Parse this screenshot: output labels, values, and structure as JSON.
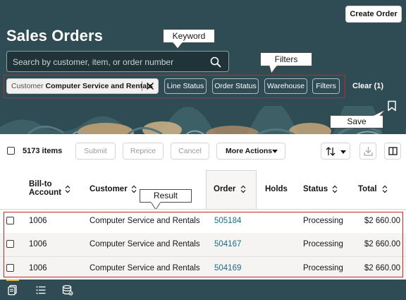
{
  "header": {
    "create_button_label": "Create Order",
    "title": "Sales Orders",
    "search_placeholder": "Search by customer, item, or order number",
    "filter_chips": {
      "customer_key": "Customer",
      "customer_value": "Computer Service and Rentals",
      "line_status": "Line Status",
      "order_status": "Order Status",
      "warehouse": "Warehouse",
      "filters": "Filters"
    },
    "clear_label": "Clear (1)"
  },
  "callouts": {
    "keyword": "Keyword",
    "filters": "Filters",
    "save": "Save",
    "result": "Result"
  },
  "toolbar": {
    "items_count": "5173 items",
    "submit": "Submit",
    "reprice": "Reprice",
    "cancel": "Cancel",
    "more_actions": "More Actions"
  },
  "table": {
    "columns": {
      "bill_to_line1": "Bill-to",
      "bill_to_line2": "Account",
      "customer": "Customer",
      "order": "Order",
      "holds": "Holds",
      "status": "Status",
      "total": "Total"
    },
    "rows": [
      {
        "account": "1006",
        "customer": "Computer Service and Rentals",
        "order": "505184",
        "holds": "",
        "status": "Processing",
        "total": "$2 660.00"
      },
      {
        "account": "1006",
        "customer": "Computer Service and Rentals",
        "order": "504167",
        "holds": "",
        "status": "Processing",
        "total": "$2 660.00"
      },
      {
        "account": "1006",
        "customer": "Computer Service and Rentals",
        "order": "504169",
        "holds": "",
        "status": "Processing",
        "total": "$2 660.00"
      }
    ]
  },
  "colors": {
    "header_bg": "#2f4b53",
    "link": "#1a6a8c",
    "annotation_red": "#c02a2e",
    "nav_active": "#e0b14a"
  },
  "icons": {
    "search": "search-icon",
    "chip_close": "close-icon",
    "bookmark": "bookmark-icon",
    "sort": "sort-icon",
    "export": "download-icon",
    "columns": "columns-icon",
    "nav": [
      "document-icon",
      "list-icon",
      "database-icon"
    ]
  }
}
